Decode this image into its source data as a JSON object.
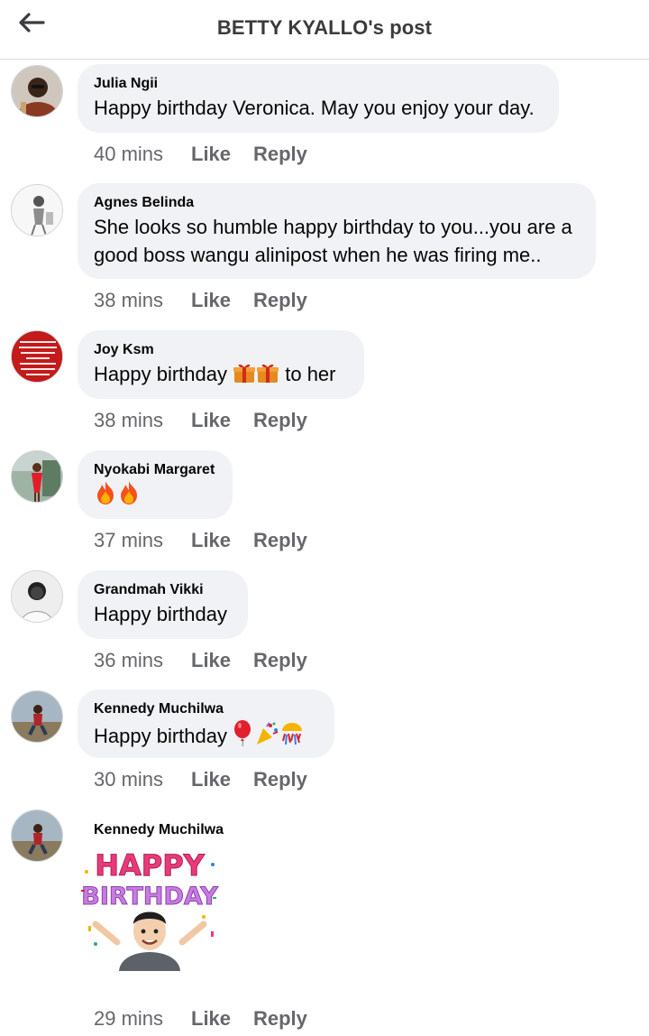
{
  "header": {
    "title": "BETTY KYALLO's post"
  },
  "actions": {
    "like": "Like",
    "reply": "Reply"
  },
  "comments": [
    {
      "author": "Julia Ngii",
      "text": "Happy birthday Veronica. May you enjoy your day.",
      "time": "40 mins"
    },
    {
      "author": "Agnes Belinda",
      "line1": "She looks so humble happy birthday to you...you are a",
      "line2": "good boss wangu alinipost when he was firing me..",
      "time": "38 mins"
    },
    {
      "author": "Joy Ksm",
      "text_a": "Happy birthday",
      "text_b": "to her",
      "time": "38 mins",
      "avatar_text": "The destiny you carry has attracted what you are going through. Don't give up now. There is greatness inside of you!"
    },
    {
      "author": "Nyokabi Margaret",
      "time": "37 mins"
    },
    {
      "author": "Grandmah Vikki",
      "text": "Happy birthday",
      "time": "36 mins"
    },
    {
      "author": "Kennedy Muchilwa",
      "text": "Happy birthday",
      "time": "30 mins"
    },
    {
      "author": "Kennedy Muchilwa",
      "time": "29 mins",
      "sticker_line1": "HAPPY",
      "sticker_line2": "BIRTHDAY"
    }
  ],
  "icons": {
    "back": "arrow-left",
    "gift": "gift",
    "fire": "fire",
    "balloon": "balloon",
    "party": "party-popper",
    "confetti": "confetti-ball"
  }
}
